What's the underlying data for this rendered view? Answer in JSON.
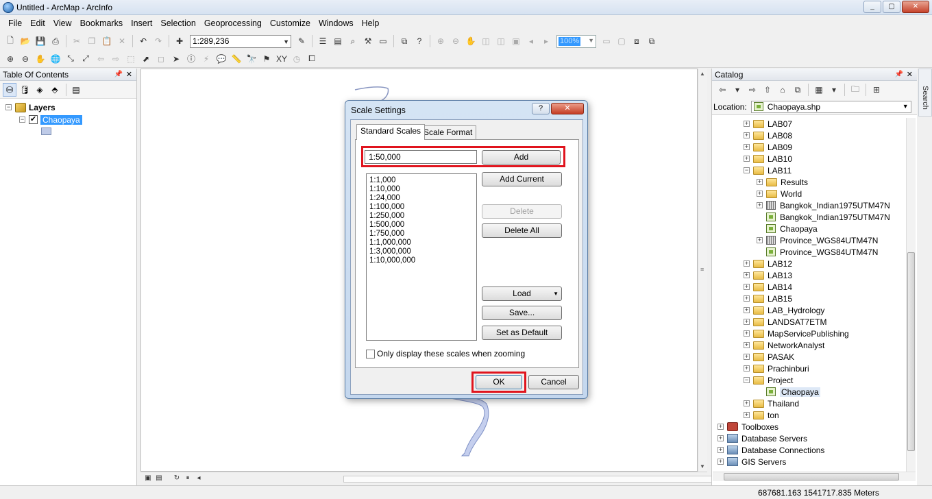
{
  "window": {
    "title": "Untitled - ArcMap - ArcInfo"
  },
  "menu": [
    "File",
    "Edit",
    "View",
    "Bookmarks",
    "Insert",
    "Selection",
    "Geoprocessing",
    "Customize",
    "Windows",
    "Help"
  ],
  "toolbar": {
    "scale_value": "1:289,236",
    "zoom_value": "100%"
  },
  "toc": {
    "title": "Table Of Contents",
    "root": "Layers",
    "layer": "Chaopaya",
    "layer_checked": "✔"
  },
  "catalog": {
    "title": "Catalog",
    "location_label": "Location:",
    "location_value": "Chaopaya.shp",
    "items": [
      {
        "label": "LAB07",
        "type": "folder",
        "level": 2,
        "expander": "+"
      },
      {
        "label": "LAB08",
        "type": "folder",
        "level": 2,
        "expander": "+"
      },
      {
        "label": "LAB09",
        "type": "folder",
        "level": 2,
        "expander": "+"
      },
      {
        "label": "LAB10",
        "type": "folder",
        "level": 2,
        "expander": "+"
      },
      {
        "label": "LAB11",
        "type": "folder",
        "level": 2,
        "expander": "−"
      },
      {
        "label": "Results",
        "type": "folder",
        "level": 3,
        "expander": "+"
      },
      {
        "label": "World",
        "type": "folder",
        "level": 3,
        "expander": "+"
      },
      {
        "label": "Bangkok_Indian1975UTM47N",
        "type": "grid",
        "level": 3,
        "expander": "+"
      },
      {
        "label": "Bangkok_Indian1975UTM47N",
        "type": "shp",
        "level": 3,
        "expander": ""
      },
      {
        "label": "Chaopaya",
        "type": "shp",
        "level": 3,
        "expander": ""
      },
      {
        "label": "Province_WGS84UTM47N",
        "type": "grid",
        "level": 3,
        "expander": "+"
      },
      {
        "label": "Province_WGS84UTM47N",
        "type": "shp",
        "level": 3,
        "expander": ""
      },
      {
        "label": "LAB12",
        "type": "folder",
        "level": 2,
        "expander": "+"
      },
      {
        "label": "LAB13",
        "type": "folder",
        "level": 2,
        "expander": "+"
      },
      {
        "label": "LAB14",
        "type": "folder",
        "level": 2,
        "expander": "+"
      },
      {
        "label": "LAB15",
        "type": "folder",
        "level": 2,
        "expander": "+"
      },
      {
        "label": "LAB_Hydrology",
        "type": "folder",
        "level": 2,
        "expander": "+"
      },
      {
        "label": "LANDSAT7ETM",
        "type": "folder",
        "level": 2,
        "expander": "+"
      },
      {
        "label": "MapServicePublishing",
        "type": "folder",
        "level": 2,
        "expander": "+"
      },
      {
        "label": "NetworkAnalyst",
        "type": "folder",
        "level": 2,
        "expander": "+"
      },
      {
        "label": "PASAK",
        "type": "folder",
        "level": 2,
        "expander": "+"
      },
      {
        "label": "Prachinburi",
        "type": "folder",
        "level": 2,
        "expander": "+"
      },
      {
        "label": "Project",
        "type": "folder",
        "level": 2,
        "expander": "−"
      },
      {
        "label": "Chaopaya",
        "type": "shp",
        "level": 3,
        "expander": "",
        "selected": true
      },
      {
        "label": "Thailand",
        "type": "folder",
        "level": 2,
        "expander": "+"
      },
      {
        "label": "ton",
        "type": "folder",
        "level": 2,
        "expander": "+"
      },
      {
        "label": "Toolboxes",
        "type": "toolbox",
        "level": 0,
        "expander": "+"
      },
      {
        "label": "Database Servers",
        "type": "db",
        "level": 0,
        "expander": "+"
      },
      {
        "label": "Database Connections",
        "type": "db",
        "level": 0,
        "expander": "+"
      },
      {
        "label": "GIS Servers",
        "type": "db",
        "level": 0,
        "expander": "+"
      }
    ]
  },
  "search_tab": "Search",
  "status": {
    "coords": "687681.163  1541717.835 Meters"
  },
  "dialog": {
    "title": "Scale Settings",
    "help": "?",
    "close": "✕",
    "tabs": [
      "Standard Scales",
      "Scale Format"
    ],
    "input_value": "1:50,000",
    "scales": [
      "1:1,000",
      "1:10,000",
      "1:24,000",
      "1:100,000",
      "1:250,000",
      "1:500,000",
      "1:750,000",
      "1:1,000,000",
      "1:3,000,000",
      "1:10,000,000"
    ],
    "buttons": {
      "add": "Add",
      "add_current": "Add Current",
      "delete": "Delete",
      "delete_all": "Delete All",
      "load": "Load",
      "save": "Save...",
      "set_default": "Set as Default",
      "ok": "OK",
      "cancel": "Cancel"
    },
    "checkbox_label": "Only display these scales when zooming"
  },
  "colors": {
    "accent": "#3399ff",
    "highlight_box": "#e0141e",
    "river": "#c5cfee"
  }
}
